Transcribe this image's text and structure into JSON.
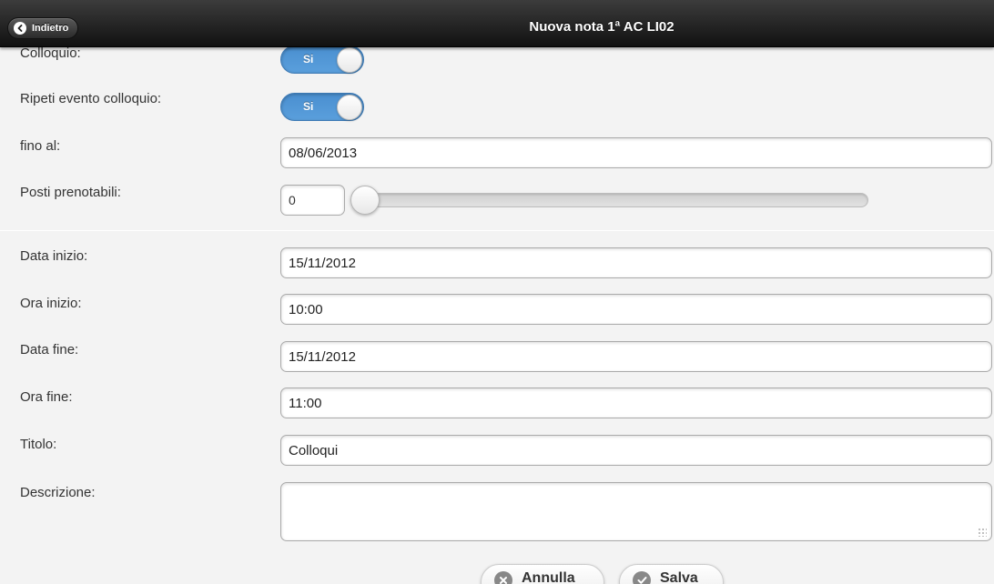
{
  "header": {
    "back_label": "Indietro",
    "title": "Nuova nota 1ª AC LI02"
  },
  "form": {
    "colloquio": {
      "label": "Colloquio:",
      "toggle_text": "Si"
    },
    "ripeti": {
      "label": "Ripeti evento colloquio:",
      "toggle_text": "Si"
    },
    "fino_al": {
      "label": "fino al:",
      "value": "08/06/2013"
    },
    "posti": {
      "label": "Posti prenotabili:",
      "value": "0"
    },
    "data_inizio": {
      "label": "Data inizio:",
      "value": "15/11/2012"
    },
    "ora_inizio": {
      "label": "Ora inizio:",
      "value": "10:00"
    },
    "data_fine": {
      "label": "Data fine:",
      "value": "15/11/2012"
    },
    "ora_fine": {
      "label": "Ora fine:",
      "value": "11:00"
    },
    "titolo": {
      "label": "Titolo:",
      "value": "Colloqui"
    },
    "descrizione": {
      "label": "Descrizione:",
      "value": ""
    }
  },
  "actions": {
    "cancel_label": "Annulla",
    "save_label": "Salva"
  },
  "colors": {
    "toggle_on": "#4a8fd0",
    "header_bg": "#1a1a1a"
  }
}
